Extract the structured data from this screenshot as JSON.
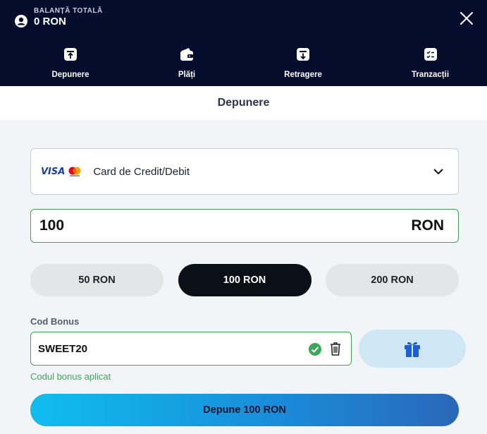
{
  "header": {
    "balance_label": "BALANȚĂ TOTALĂ",
    "balance_value": "0 RON",
    "user_icon": "user-circle-icon",
    "close_icon": "close-icon"
  },
  "nav": {
    "items": [
      {
        "label": "Depunere",
        "icon": "deposit-icon"
      },
      {
        "label": "Plăți",
        "icon": "wallet-icon"
      },
      {
        "label": "Retragere",
        "icon": "withdraw-icon"
      },
      {
        "label": "Tranzacții",
        "icon": "transactions-icon"
      }
    ]
  },
  "page_title": "Depunere",
  "method": {
    "visa_text": "VISA",
    "label": "Card de Credit/Debit"
  },
  "amount": {
    "value": "100",
    "currency": "RON"
  },
  "quick_amounts": [
    "50 RON",
    "100 RON",
    "200 RON"
  ],
  "selected_amount": "100 RON",
  "bonus": {
    "label": "Cod Bonus",
    "code": "SWEET20",
    "status": "Codul bonus aplicat"
  },
  "submit_label": "Depune 100 RON",
  "colors": {
    "header_bg": "#040d2c",
    "success": "#3aa856",
    "accent_blue": "#0fbdf0",
    "chip_active": "#0b0f17"
  }
}
